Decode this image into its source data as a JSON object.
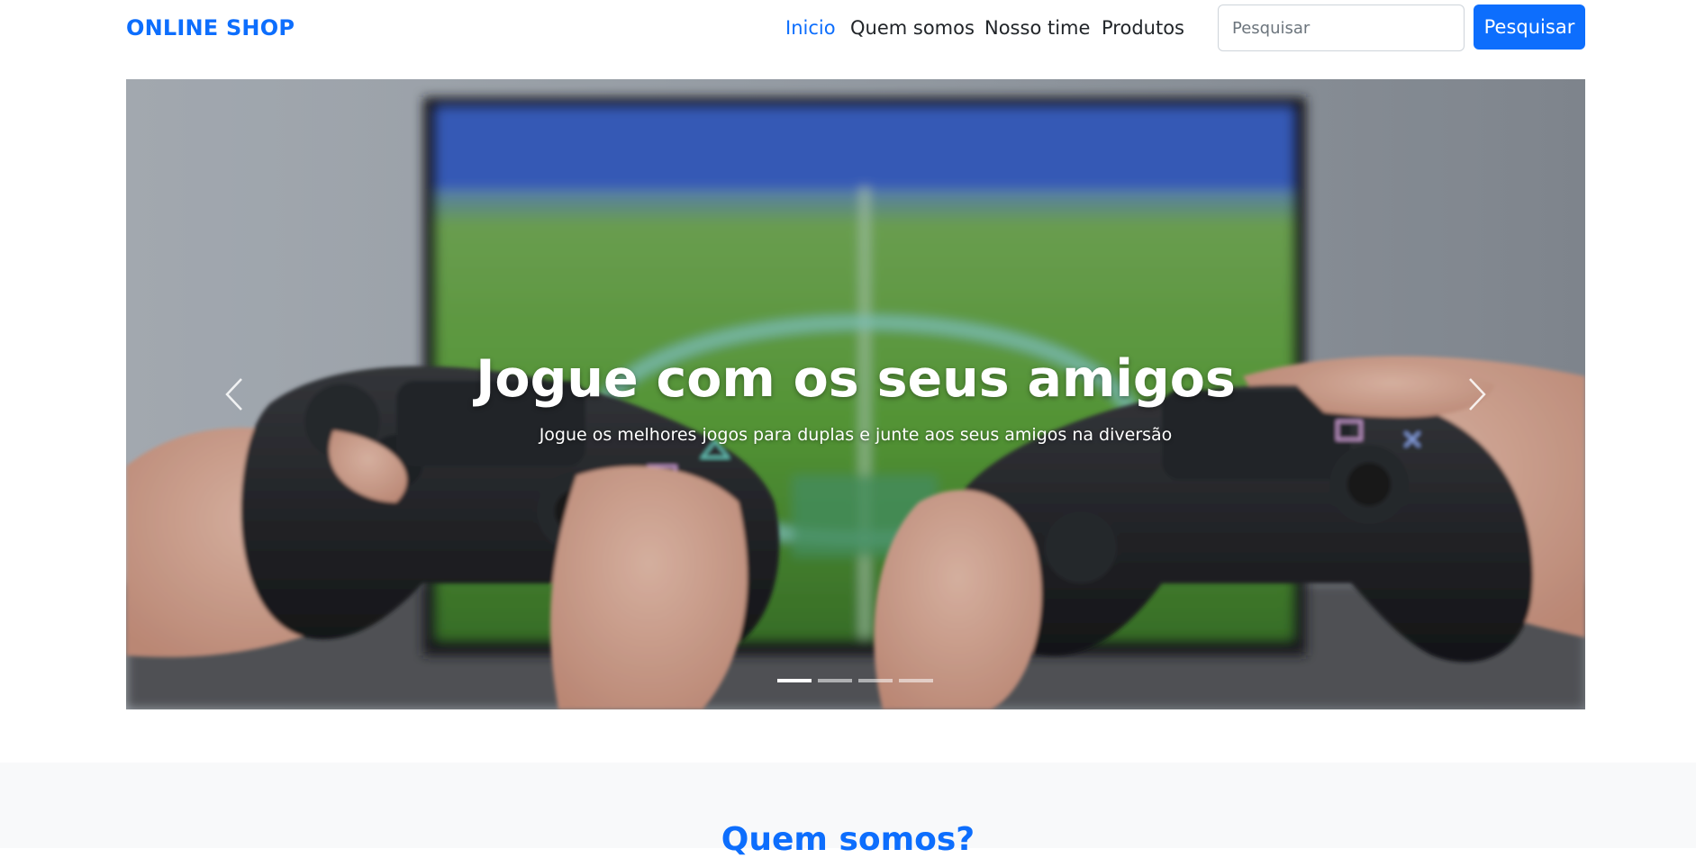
{
  "navbar": {
    "brand": "ONLINE SHOP",
    "links": [
      {
        "label": "Inicio",
        "active": true
      },
      {
        "label": "Quem somos",
        "active": false
      },
      {
        "label": "Nosso time",
        "active": false
      },
      {
        "label": "Produtos",
        "active": false
      }
    ],
    "search": {
      "placeholder": "Pesquisar",
      "value": "",
      "button_label": "Pesquisar"
    }
  },
  "carousel": {
    "slide_count": 4,
    "active_index": 0,
    "caption_title": "Jogue com os seus amigos",
    "caption_text": "Jogue os melhores jogos para duplas e junte aos seus amigos na diversão",
    "image_subject": "two hands holding game controllers in front of a football video game on a TV",
    "prev_icon": "chevron-left-icon",
    "next_icon": "chevron-right-icon"
  },
  "about": {
    "title": "Quem somos?"
  },
  "colors": {
    "primary": "#0d6efd",
    "text": "#212529",
    "section_bg": "#f8f9fa"
  }
}
